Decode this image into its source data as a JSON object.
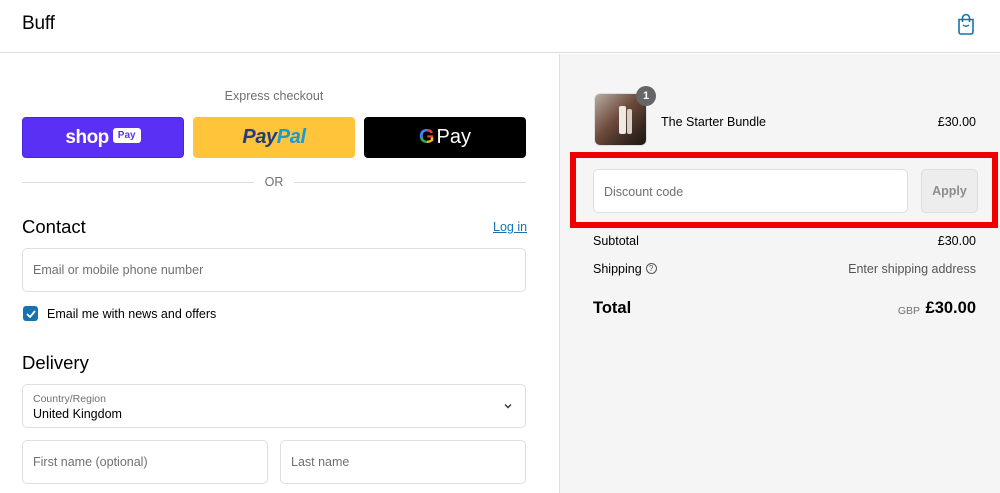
{
  "header": {
    "brand": "Buff",
    "cart_icon": "shopping-bag-icon"
  },
  "express": {
    "label": "Express checkout",
    "shop_text": "shop",
    "shop_pay_badge": "Pay",
    "paypal_a": "Pay",
    "paypal_b": "Pal",
    "gpay_g": "G",
    "gpay_text": "Pay",
    "or": "OR"
  },
  "contact": {
    "title": "Contact",
    "login": "Log in",
    "email_placeholder": "Email or mobile phone number",
    "newsletter_label": "Email me with news and offers",
    "newsletter_checked": true
  },
  "delivery": {
    "title": "Delivery",
    "country_label": "Country/Region",
    "country_value": "United Kingdom",
    "first_name_placeholder": "First name (optional)",
    "last_name_placeholder": "Last name"
  },
  "order": {
    "item": {
      "name": "The Starter Bundle",
      "price": "£30.00",
      "quantity": "1"
    },
    "discount_placeholder": "Discount code",
    "apply_label": "Apply",
    "subtotal_label": "Subtotal",
    "subtotal_value": "£30.00",
    "shipping_label": "Shipping",
    "shipping_value": "Enter shipping address",
    "total_label": "Total",
    "total_currency": "GBP",
    "total_value": "£30.00"
  },
  "colors": {
    "accent": "#1773b0",
    "shop_pay": "#5a31f4",
    "paypal": "#ffc439",
    "highlight": "#f10000"
  }
}
